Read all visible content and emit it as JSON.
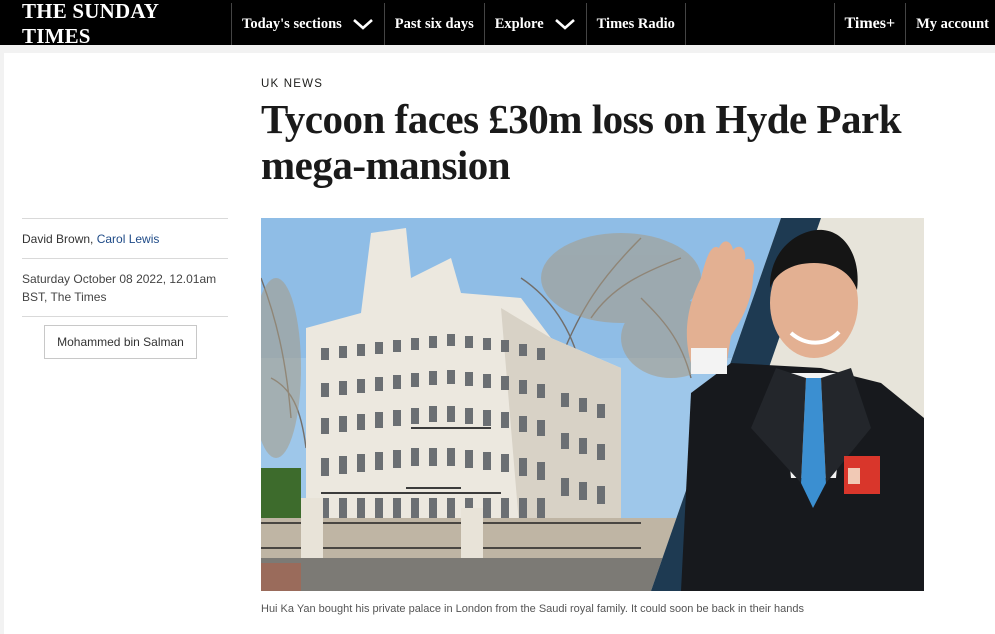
{
  "nav": {
    "brand": "THE SUNDAY TIMES",
    "sections_label": "Today's sections",
    "past_label": "Past six days",
    "explore_label": "Explore",
    "radio_label": "Times Radio",
    "timesplus_label": "Times+",
    "account_label": "My account"
  },
  "article": {
    "section": "UK NEWS",
    "headline": "Tycoon faces £30m loss on Hyde Park mega-mansion",
    "author_1": "David Brown",
    "author_sep": ", ",
    "author_2": "Carol Lewis",
    "date_line_1": "Saturday October 08 2022, 12.01am",
    "date_line_2": "BST, The Times",
    "tag": "Mohammed bin Salman",
    "caption": "Hui Ka Yan bought his private palace in London from the Saudi royal family. It could soon be back in their hands"
  },
  "colors": {
    "nav_bg": "#000000",
    "link": "#1e4a87",
    "tie_blue": "#3b8fd1"
  }
}
